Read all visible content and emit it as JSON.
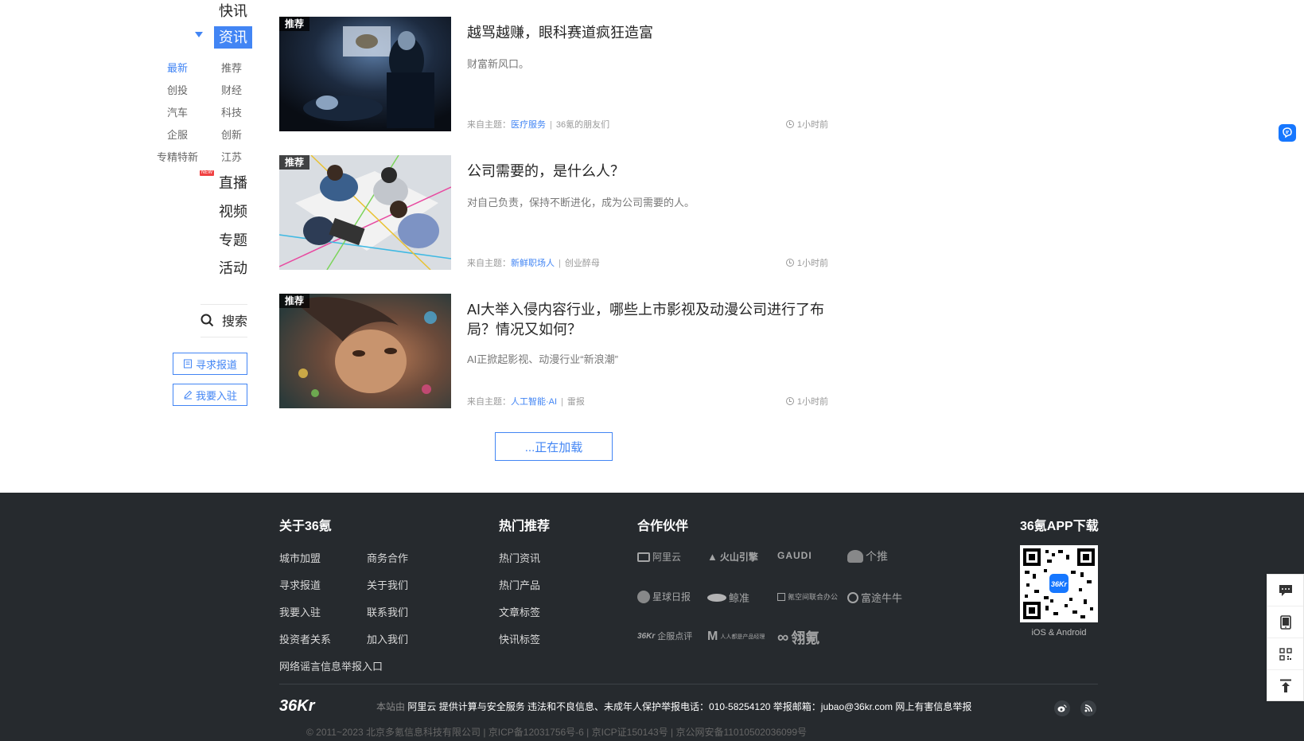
{
  "nav": {
    "items": [
      "快讯",
      "资讯",
      "直播",
      "视频",
      "专题",
      "活动"
    ],
    "active": "资讯",
    "sub_items": [
      "最新",
      "推荐",
      "创投",
      "财经",
      "汽车",
      "科技",
      "企服",
      "创新",
      "专精特新",
      "江苏"
    ],
    "new_badge": "NEW",
    "search_label": "搜索",
    "seek_report": "寻求报道",
    "join": "我要入驻"
  },
  "articles": [
    {
      "tag": "推荐",
      "title": "越骂越赚，眼科赛道疯狂造富",
      "summary": "财富新风口。",
      "meta_prefix": "来自主题：",
      "topic": "医疗服务",
      "author": "36氪的朋友们",
      "time": "1小时前"
    },
    {
      "tag": "推荐",
      "title": "公司需要的，是什么人？",
      "summary": "对自己负责，保持不断进化，成为公司需要的人。",
      "meta_prefix": "来自主题：",
      "topic": "新鲜职场人",
      "author": "创业醉母",
      "time": "1小时前"
    },
    {
      "tag": "推荐",
      "title": "AI大举入侵内容行业，哪些上市影视及动漫公司进行了布局？情况又如何？",
      "summary": "AI正掀起影视、动漫行业“新浪潮”",
      "meta_prefix": "来自主题：",
      "topic": "人工智能·AI",
      "author": "雷报",
      "time": "1小时前"
    }
  ],
  "loading": "...正在加载",
  "footer": {
    "about_title": "关于36氪",
    "about_links": [
      "城市加盟",
      "商务合作",
      "寻求报道",
      "关于我们",
      "我要入驻",
      "联系我们",
      "投资者关系",
      "加入我们",
      "网络谣言信息举报入口"
    ],
    "hot_title": "热门推荐",
    "hot_links": [
      "热门资讯",
      "热门产品",
      "文章标签",
      "快讯标签"
    ],
    "partner_title": "合作伙伴",
    "partners": [
      "阿里云",
      "火山引擎",
      "GAUDI",
      "个推",
      "星球日报",
      "鲸准",
      "氪空间联合办公",
      "富途牛牛",
      "企服点评",
      "人人都是产品经理",
      "翎氪"
    ],
    "app_title": "36氪APP下载",
    "app_caption": "iOS & Android",
    "logo": "36Kr",
    "notice_dim": "本站由",
    "notice_text": "阿里云 提供计算与安全服务 违法和不良信息、未成年人保护举报电话：010-58254120 举报邮箱：jubao@36kr.com 网上有害信息举报",
    "copyright": "© 2011~2023 北京多氪信息科技有限公司 | 京ICP备12031756号-6 | 京ICP证150143号 | 京公网安备11010502036099号"
  },
  "colors": {
    "accent": "#4285f4",
    "footer_bg": "#262a2e",
    "badge_red": "#f04142"
  }
}
